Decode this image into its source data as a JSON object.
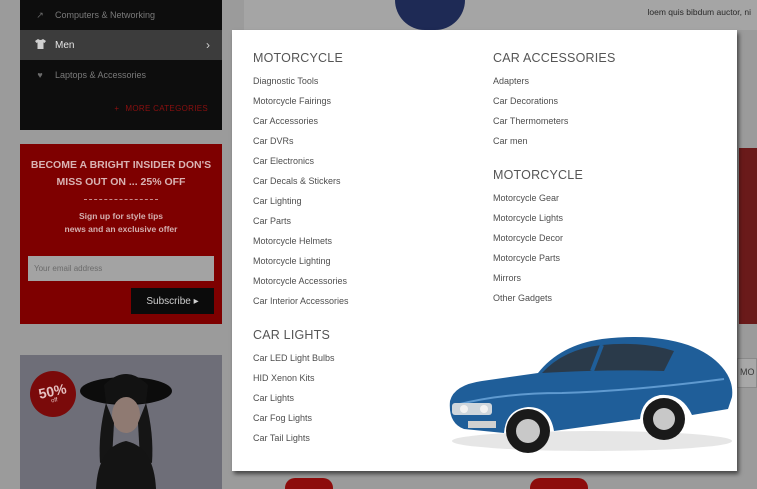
{
  "sidebar": {
    "items": [
      {
        "label": "Computers & Networking",
        "icon": "chart-icon"
      },
      {
        "label": "Men",
        "icon": "shirt-icon",
        "active": true
      },
      {
        "label": "Laptops & Accessories",
        "icon": "heart-icon"
      }
    ],
    "more_label": "MORE CATEGORIES"
  },
  "promo": {
    "title": "BECOME A BRIGHT INSIDER DON'S MISS OUT ON ... 25% OFF",
    "text_line1": "Sign up for style tips",
    "text_line2": "news and an exclusive offer",
    "email_placeholder": "Your email address",
    "subscribe_label": "Subscribe"
  },
  "banner": {
    "badge_pct": "50%",
    "badge_off": "off"
  },
  "hero": {
    "caption": "loem quis bibdum auctor, ni"
  },
  "right_box_text": "MO",
  "mega_menu": {
    "groups_left": [
      {
        "title": "MOTORCYCLE",
        "links": [
          "Diagnostic Tools",
          "Motorcycle Fairings",
          "Car Accessories",
          "Car DVRs",
          "Car Electronics",
          "Car Decals & Stickers",
          "Car Lighting",
          "Car Parts",
          "Motorcycle Helmets",
          "Motorcycle Lighting",
          "Motorcycle Accessories",
          "Car Interior Accessories"
        ]
      },
      {
        "title": "CAR LIGHTS",
        "links": [
          "Car LED Light Bulbs",
          "HID Xenon Kits",
          "Car Lights",
          "Car Fog Lights",
          "Car Tail Lights"
        ]
      }
    ],
    "groups_right": [
      {
        "title": "CAR ACCESSORIES",
        "links": [
          "Adapters",
          "Car Decorations",
          "Car Thermometers",
          "Car men"
        ]
      },
      {
        "title": "MOTORCYCLE",
        "links": [
          "Motorcycle Gear",
          "Motorcycle Lights",
          "Motorcycle Decor",
          "Motorcycle Parts",
          "Mirrors",
          "Other Gadgets"
        ]
      }
    ]
  },
  "colors": {
    "car_body": "#1f5e99",
    "promo_red": "#7e0000",
    "menu_bg": "#ffffff"
  }
}
